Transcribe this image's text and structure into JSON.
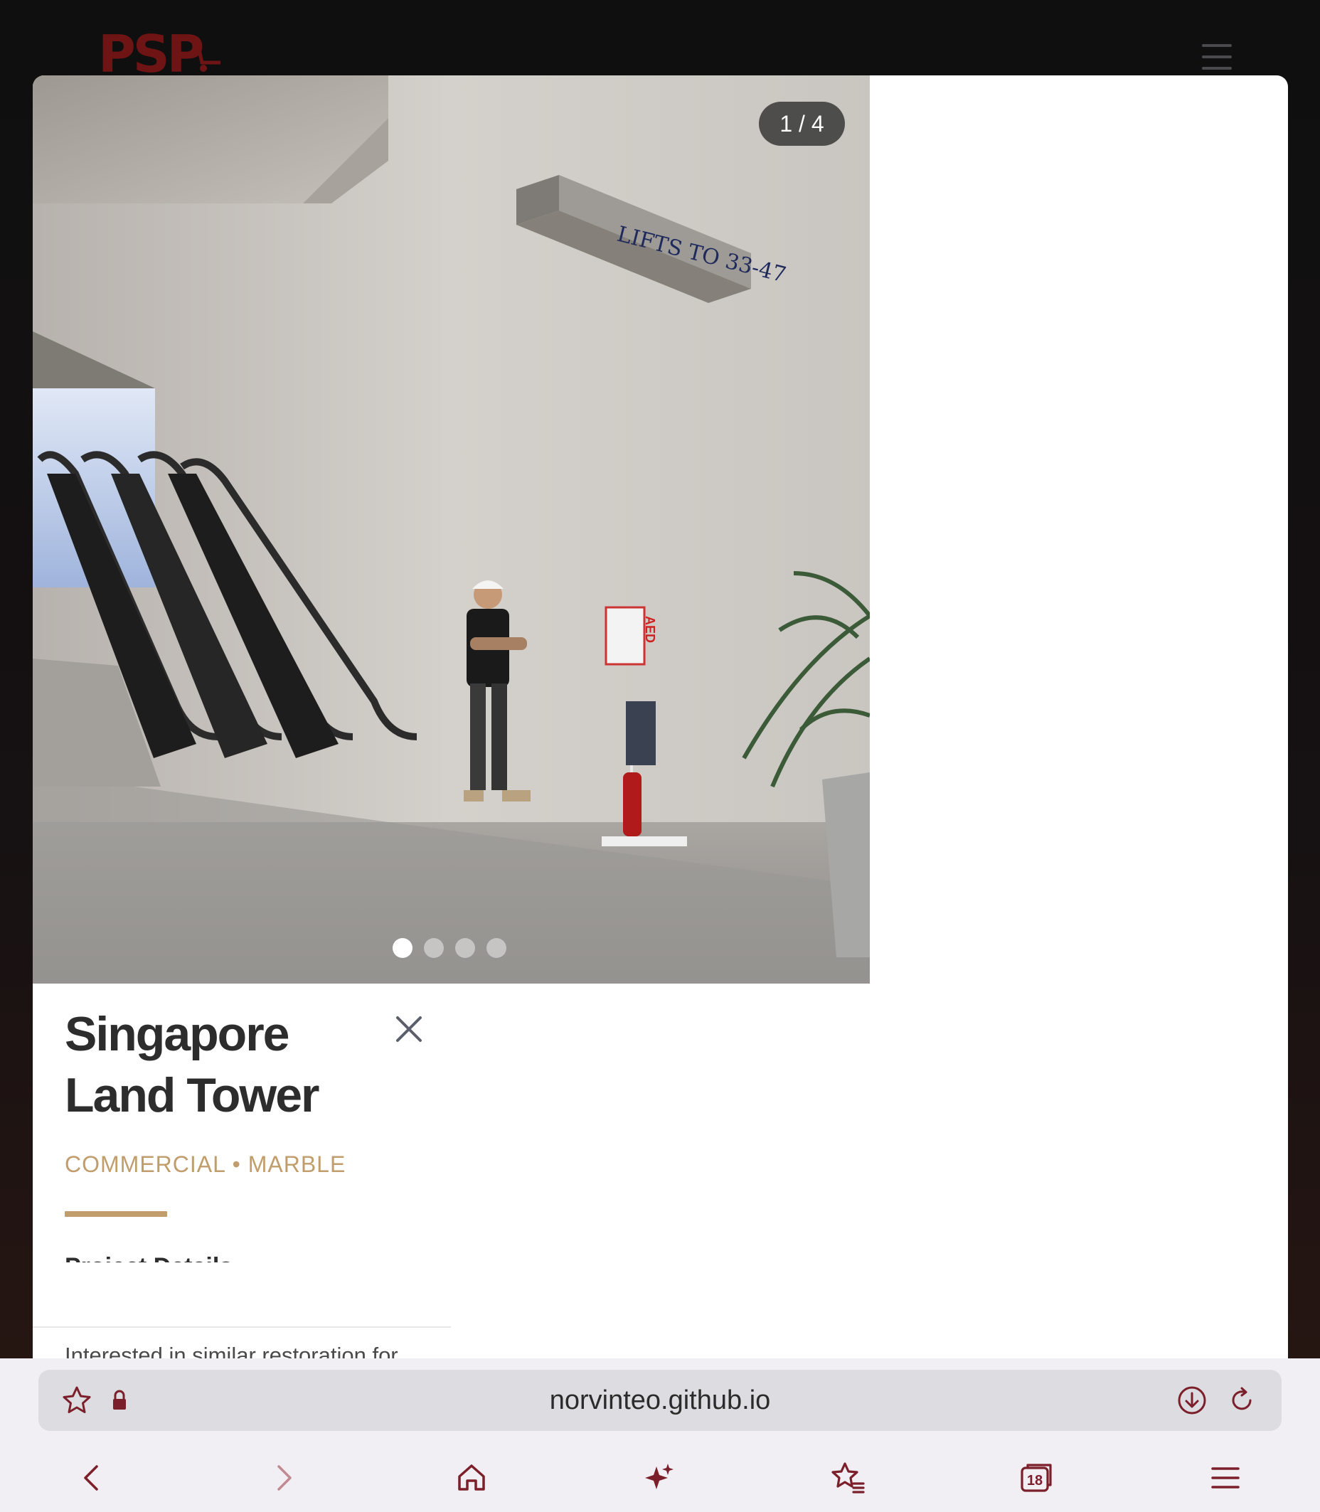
{
  "site": {
    "logo_text": "PSP",
    "menu_icon": "hamburger-icon"
  },
  "modal": {
    "gallery": {
      "counter": "1 / 4",
      "total_images": 4,
      "current_index": 1,
      "photo_sign_text": "LIFTS TO 33-47",
      "photo_sign_aed": "AED"
    },
    "title": "Singapore Land Tower",
    "tags": "COMMERCIAL • MARBLE",
    "section_heading": "Project Details",
    "cta_text": "Interested in similar restoration for your property?",
    "close_icon": "close-icon"
  },
  "browser": {
    "url": "norvinteo.github.io",
    "tab_count": "18",
    "icons": {
      "bookmark": "star-icon",
      "lock": "lock-icon",
      "download": "download-icon",
      "reload": "reload-icon",
      "back": "back-icon",
      "forward": "forward-icon",
      "home": "home-icon",
      "ai": "sparkle-icon",
      "bookmarks": "bookmarks-icon",
      "tabs": "tabs-icon",
      "menu": "menu-icon"
    }
  },
  "colors": {
    "accent_gold": "#c29d6c",
    "logo_red": "#6e1414",
    "browser_icon": "#7b1f2a",
    "cta_green": "#2e8b57"
  }
}
